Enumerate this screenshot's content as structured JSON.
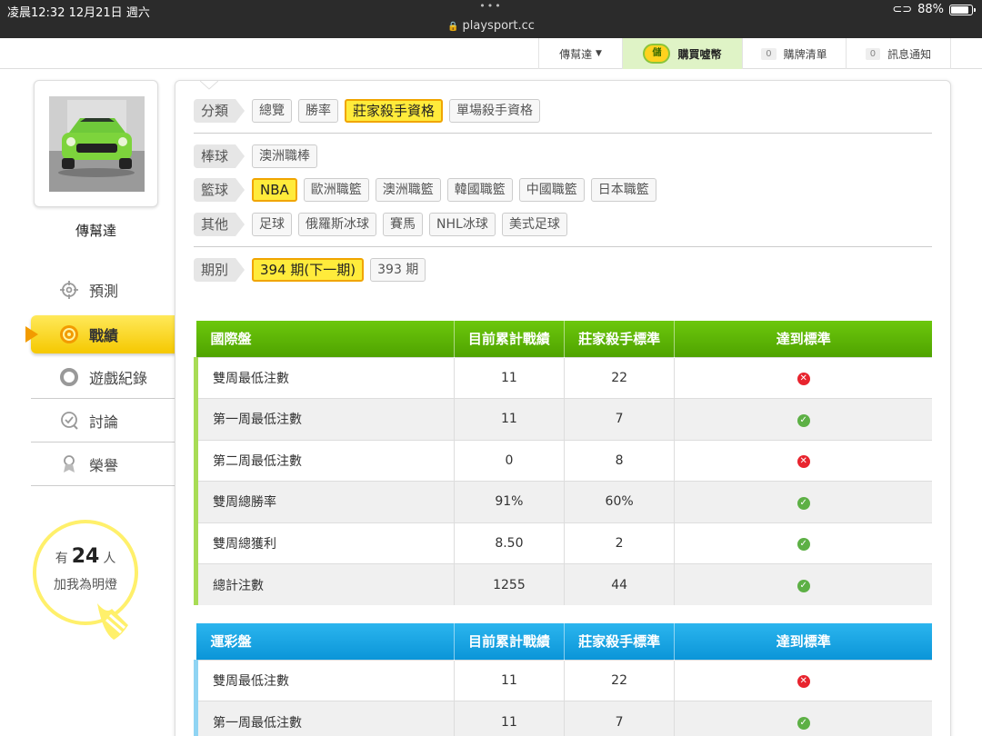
{
  "statusbar": {
    "time": "凌晨12:32   12月21日 週六",
    "dots": "•••",
    "url": "playsport.cc",
    "battery": "88%",
    "battery_level": 0.88
  },
  "topnav": {
    "user": "傳幫達",
    "buy_coin_icon": "儲",
    "buy": "購買噓幣",
    "cart_count": "0",
    "cart": "購牌清單",
    "notify_count": "0",
    "notify": "訊息通知"
  },
  "sidebar": {
    "username": "傳幫達",
    "menu": [
      {
        "label": "預測",
        "icon": "crosshair-icon"
      },
      {
        "label": "戰績",
        "icon": "target-icon"
      },
      {
        "label": "遊戲紀錄",
        "icon": "ring-icon"
      },
      {
        "label": "討論",
        "icon": "chat-icon"
      },
      {
        "label": "榮譽",
        "icon": "medal-icon"
      }
    ],
    "fans_prefix": "有",
    "fans_count": "24",
    "fans_suffix": "人",
    "fans_text": "加我為明燈"
  },
  "filters": {
    "category": {
      "label": "分類",
      "options": [
        "總覽",
        "勝率",
        "莊家殺手資格",
        "單場殺手資格"
      ],
      "selected": "莊家殺手資格"
    },
    "baseball": {
      "label": "棒球",
      "options": [
        "澳洲職棒"
      ]
    },
    "basketball": {
      "label": "籃球",
      "options": [
        "NBA",
        "歐洲職籃",
        "澳洲職籃",
        "韓國職籃",
        "中國職籃",
        "日本職籃"
      ],
      "selected": "NBA"
    },
    "other": {
      "label": "其他",
      "options": [
        "足球",
        "俄羅斯冰球",
        "賽馬",
        "NHL冰球",
        "美式足球"
      ]
    },
    "period": {
      "label": "期別",
      "options": [
        "394 期(下一期)",
        "393 期"
      ],
      "selected": "394 期(下一期)"
    }
  },
  "table_intl": {
    "headers": [
      "國際盤",
      "目前累計戰績",
      "莊家殺手標準",
      "達到標準"
    ],
    "rows": [
      {
        "name": "雙周最低注數",
        "current": "11",
        "standard": "22",
        "met": false
      },
      {
        "name": "第一周最低注數",
        "current": "11",
        "standard": "7",
        "met": true
      },
      {
        "name": "第二周最低注數",
        "current": "0",
        "standard": "8",
        "met": false
      },
      {
        "name": "雙周總勝率",
        "current": "91%",
        "standard": "60%",
        "met": true
      },
      {
        "name": "雙周總獲利",
        "current": "8.50",
        "standard": "2",
        "met": true
      },
      {
        "name": "總計注數",
        "current": "1255",
        "standard": "44",
        "met": true
      }
    ]
  },
  "table_lottery": {
    "headers": [
      "運彩盤",
      "目前累計戰績",
      "莊家殺手標準",
      "達到標準"
    ],
    "rows": [
      {
        "name": "雙周最低注數",
        "current": "11",
        "standard": "22",
        "met": false
      },
      {
        "name": "第一周最低注數",
        "current": "11",
        "standard": "7",
        "met": true
      }
    ]
  },
  "marks": {
    "yes": "✓",
    "no": "✕"
  }
}
